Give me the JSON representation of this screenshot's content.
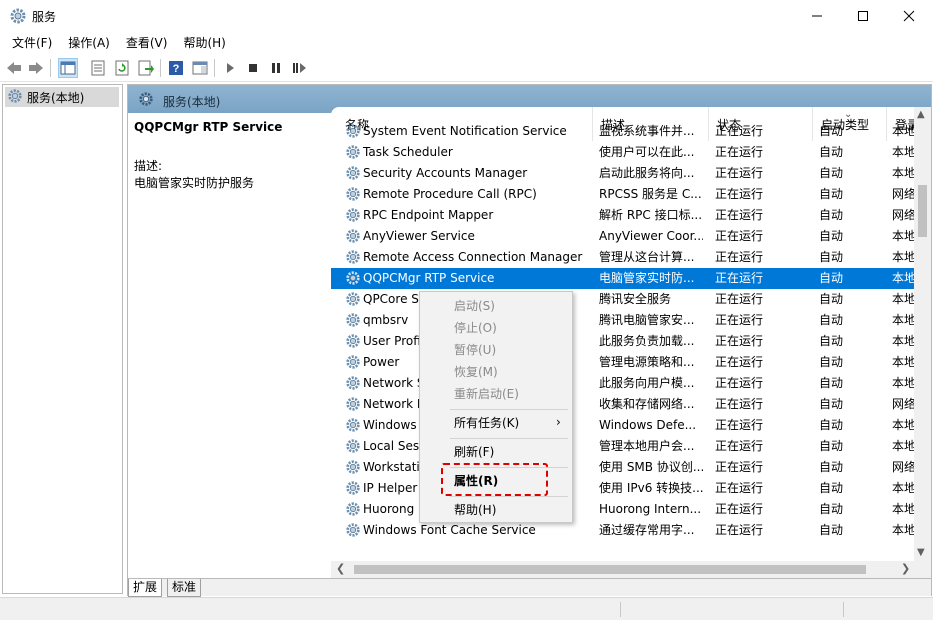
{
  "window": {
    "title": "服务",
    "icon": "gear-icon"
  },
  "menu": [
    "文件(F)",
    "操作(A)",
    "查看(V)",
    "帮助(H)"
  ],
  "tree": {
    "root_label": "服务(本地)"
  },
  "pane": {
    "header": "服务(本地)",
    "selected_service_title": "QQPCMgr RTP Service",
    "desc_label": "描述:",
    "desc_text": "电脑管家实时防护服务"
  },
  "columns": [
    "名称",
    "描述",
    "状态",
    "启动类型",
    "登录"
  ],
  "rows": [
    {
      "name": "System Event Notification Service",
      "desc": "监视系统事件并...",
      "status": "正在运行",
      "start": "自动",
      "logon": "本地"
    },
    {
      "name": "Task Scheduler",
      "desc": "使用户可以在此...",
      "status": "正在运行",
      "start": "自动",
      "logon": "本地"
    },
    {
      "name": "Security Accounts Manager",
      "desc": "启动此服务将向...",
      "status": "正在运行",
      "start": "自动",
      "logon": "本地"
    },
    {
      "name": "Remote Procedure Call (RPC)",
      "desc": "RPCSS 服务是 C...",
      "status": "正在运行",
      "start": "自动",
      "logon": "网络"
    },
    {
      "name": "RPC Endpoint Mapper",
      "desc": "解析 RPC 接口标...",
      "status": "正在运行",
      "start": "自动",
      "logon": "网络"
    },
    {
      "name": "AnyViewer Service",
      "desc": "AnyViewer Coor...",
      "status": "正在运行",
      "start": "自动",
      "logon": "本地"
    },
    {
      "name": "Remote Access Connection Manager",
      "desc": "管理从这台计算...",
      "status": "正在运行",
      "start": "自动",
      "logon": "本地"
    },
    {
      "name": "QQPCMgr RTP Service",
      "desc": "电脑管家实时防...",
      "status": "正在运行",
      "start": "自动",
      "logon": "本地",
      "selected": true
    },
    {
      "name": "QPCore Service",
      "desc": "腾讯安全服务",
      "status": "正在运行",
      "start": "自动",
      "logon": "本地"
    },
    {
      "name": "qmbsrv",
      "desc": "腾讯电脑管家安...",
      "status": "正在运行",
      "start": "自动",
      "logon": "本地"
    },
    {
      "name": "User Profile Service",
      "desc": "此服务负责加载...",
      "status": "正在运行",
      "start": "自动",
      "logon": "本地"
    },
    {
      "name": "Power",
      "desc": "管理电源策略和...",
      "status": "正在运行",
      "start": "自动",
      "logon": "本地"
    },
    {
      "name": "Network Store Interface Service",
      "desc": "此服务向用户模...",
      "status": "正在运行",
      "start": "自动",
      "logon": "本地"
    },
    {
      "name": "Network List Service",
      "desc": "收集和存储网络...",
      "status": "正在运行",
      "start": "自动",
      "logon": "网络"
    },
    {
      "name": "Windows Defender Firewall",
      "desc": "Windows Defe...",
      "status": "正在运行",
      "start": "自动",
      "logon": "本地"
    },
    {
      "name": "Local Session Manager",
      "desc": "管理本地用户会...",
      "status": "正在运行",
      "start": "自动",
      "logon": "本地"
    },
    {
      "name": "Workstation",
      "desc": "使用 SMB 协议创...",
      "status": "正在运行",
      "start": "自动",
      "logon": "网络"
    },
    {
      "name": "IP Helper",
      "desc": "使用 IPv6 转换技...",
      "status": "正在运行",
      "start": "自动",
      "logon": "本地"
    },
    {
      "name": "Huorong Internet Security Daemon",
      "desc": "Huorong Intern...",
      "status": "正在运行",
      "start": "自动",
      "logon": "本地"
    },
    {
      "name": "Windows Font Cache Service",
      "desc": "通过缓存常用字...",
      "status": "正在运行",
      "start": "自动",
      "logon": "本地"
    }
  ],
  "context_menu": {
    "start": "启动(S)",
    "stop": "停止(O)",
    "pause": "暂停(U)",
    "resume": "恢复(M)",
    "restart": "重新启动(E)",
    "all_tasks": "所有任务(K)",
    "refresh": "刷新(F)",
    "properties": "属性(R)",
    "help": "帮助(H)"
  },
  "tabs": [
    "扩展",
    "标准"
  ],
  "colors": {
    "selection": "#0078d7",
    "header_band": "#8fb4d1",
    "highlight": "#e00000"
  }
}
